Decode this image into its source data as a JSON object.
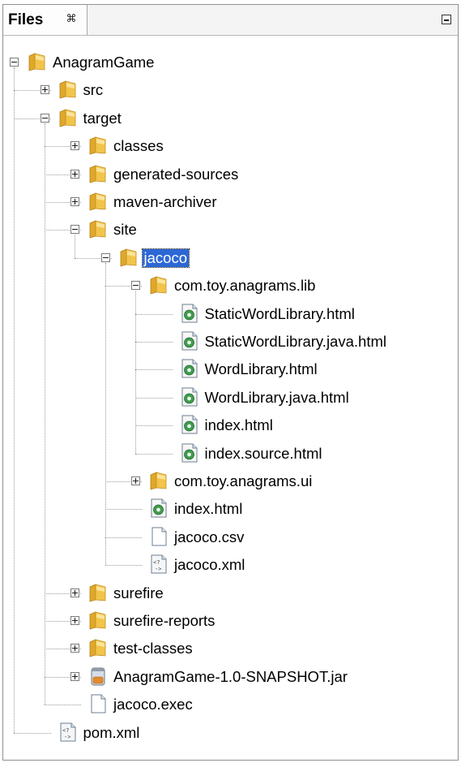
{
  "panel": {
    "tab_title": "Files",
    "close_glyph": "⌘"
  },
  "tree": [
    {
      "label": "AnagramGame",
      "level": 0,
      "type": "folder",
      "expander": "minus"
    },
    {
      "label": "src",
      "level": 1,
      "type": "folder",
      "expander": "plus"
    },
    {
      "label": "target",
      "level": 1,
      "type": "folder",
      "expander": "minus"
    },
    {
      "label": "classes",
      "level": 2,
      "type": "folder",
      "expander": "plus"
    },
    {
      "label": "generated-sources",
      "level": 2,
      "type": "folder",
      "expander": "plus"
    },
    {
      "label": "maven-archiver",
      "level": 2,
      "type": "folder",
      "expander": "plus"
    },
    {
      "label": "site",
      "level": 2,
      "type": "folder",
      "expander": "minus"
    },
    {
      "label": "jacoco",
      "level": 3,
      "type": "folder",
      "expander": "minus",
      "selected": true
    },
    {
      "label": "com.toy.anagrams.lib",
      "level": 4,
      "type": "folder",
      "expander": "minus"
    },
    {
      "label": "StaticWordLibrary.html",
      "level": 5,
      "type": "html",
      "expander": "none"
    },
    {
      "label": "StaticWordLibrary.java.html",
      "level": 5,
      "type": "html",
      "expander": "none"
    },
    {
      "label": "WordLibrary.html",
      "level": 5,
      "type": "html",
      "expander": "none"
    },
    {
      "label": "WordLibrary.java.html",
      "level": 5,
      "type": "html",
      "expander": "none"
    },
    {
      "label": "index.html",
      "level": 5,
      "type": "html",
      "expander": "none"
    },
    {
      "label": "index.source.html",
      "level": 5,
      "type": "html",
      "expander": "none"
    },
    {
      "label": "com.toy.anagrams.ui",
      "level": 4,
      "type": "folder",
      "expander": "plus"
    },
    {
      "label": "index.html",
      "level": 4,
      "type": "html",
      "expander": "none"
    },
    {
      "label": "jacoco.csv",
      "level": 4,
      "type": "file",
      "expander": "none"
    },
    {
      "label": "jacoco.xml",
      "level": 4,
      "type": "xml",
      "expander": "none"
    },
    {
      "label": "surefire",
      "level": 2,
      "type": "folder",
      "expander": "plus"
    },
    {
      "label": "surefire-reports",
      "level": 2,
      "type": "folder",
      "expander": "plus"
    },
    {
      "label": "test-classes",
      "level": 2,
      "type": "folder",
      "expander": "plus"
    },
    {
      "label": "AnagramGame-1.0-SNAPSHOT.jar",
      "level": 2,
      "type": "jar",
      "expander": "plus"
    },
    {
      "label": "jacoco.exec",
      "level": 2,
      "type": "file",
      "expander": "none"
    },
    {
      "label": "pom.xml",
      "level": 1,
      "type": "xml",
      "expander": "none"
    }
  ],
  "colors": {
    "selection": "#2c67d5",
    "folder": "#f2c44a",
    "html_badge": "#3f9a4e",
    "jar": "#e58a2a"
  },
  "icons": {
    "folder": "folder-icon",
    "html": "html-file-icon",
    "file": "text-file-icon",
    "xml": "xml-file-icon",
    "jar": "jar-file-icon",
    "expand": "expand-plus-icon",
    "collapse": "collapse-minus-icon",
    "minimize": "minimize-icon",
    "close": "close-tab-icon"
  }
}
